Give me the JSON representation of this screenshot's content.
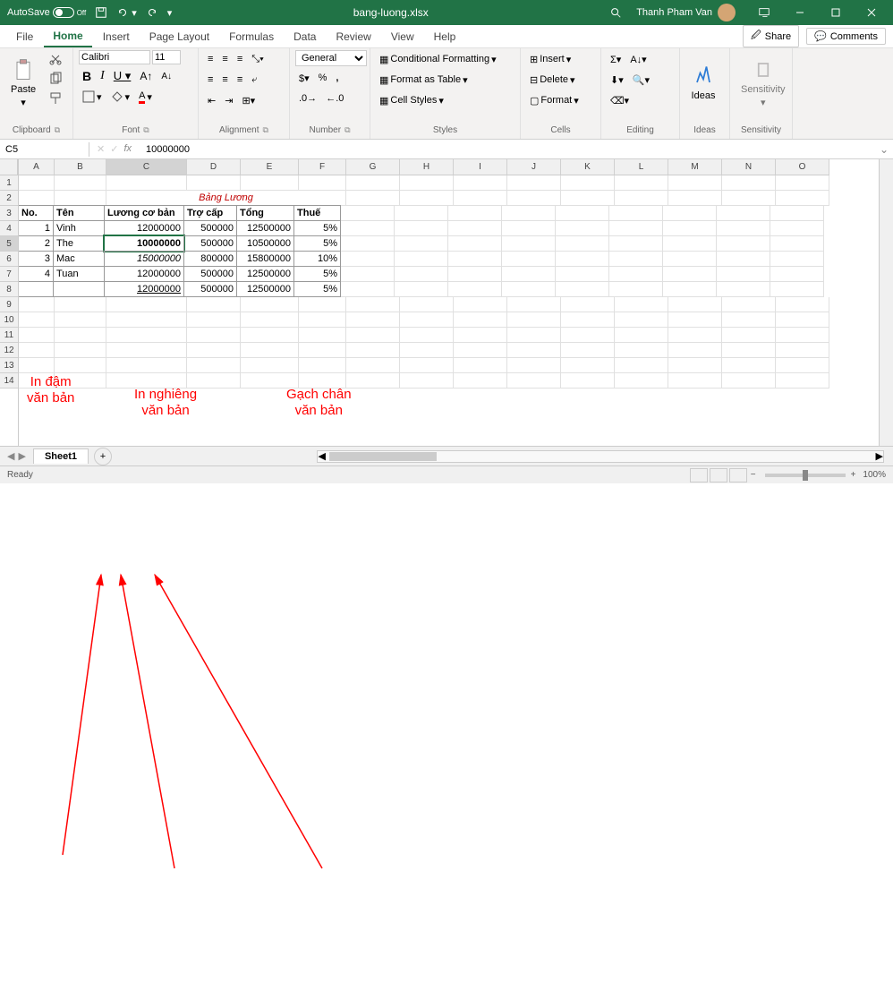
{
  "titlebar": {
    "autosave": "AutoSave",
    "autosave_state": "Off",
    "filename": "bang-luong.xlsx",
    "user": "Thanh Pham Van"
  },
  "menu": {
    "file": "File",
    "home": "Home",
    "insert": "Insert",
    "page_layout": "Page Layout",
    "formulas": "Formulas",
    "data": "Data",
    "review": "Review",
    "view": "View",
    "help": "Help",
    "share": "Share",
    "comments": "Comments"
  },
  "ribbon": {
    "clipboard": "Clipboard",
    "paste": "Paste",
    "font": "Font",
    "font_name": "Calibri",
    "font_size": "11",
    "alignment": "Alignment",
    "number": "Number",
    "number_format": "General",
    "styles": "Styles",
    "cond_fmt": "Conditional Formatting",
    "fmt_table": "Format as Table",
    "cell_styles": "Cell Styles",
    "cells": "Cells",
    "insert": "Insert",
    "delete": "Delete",
    "format": "Format",
    "editing": "Editing",
    "ideas": "Ideas",
    "sensitivity": "Sensitivity"
  },
  "namebox": {
    "ref": "C5",
    "formula": "10000000",
    "fx": "fx"
  },
  "columns": [
    "A",
    "B",
    "C",
    "D",
    "E",
    "F",
    "G",
    "H",
    "I",
    "J",
    "K",
    "L",
    "M",
    "N",
    "O"
  ],
  "rows": [
    "1",
    "2",
    "3",
    "4",
    "5",
    "6",
    "7",
    "8",
    "9",
    "10",
    "11",
    "12",
    "13",
    "14"
  ],
  "table": {
    "title": "Bảng Lương",
    "headers": {
      "no": "No.",
      "ten": "Tên",
      "luong": "Lương cơ bản",
      "trocap": "Trợ cấp",
      "tong": "Tổng",
      "thue": "Thuế"
    },
    "rows": [
      {
        "no": "1",
        "ten": "Vinh",
        "luong": "12000000",
        "trocap": "500000",
        "tong": "12500000",
        "thue": "5%"
      },
      {
        "no": "2",
        "ten": "The",
        "luong": "10000000",
        "trocap": "500000",
        "tong": "10500000",
        "thue": "5%"
      },
      {
        "no": "3",
        "ten": "Mac",
        "luong": "15000000",
        "trocap": "800000",
        "tong": "15800000",
        "thue": "10%"
      },
      {
        "no": "4",
        "ten": "Tuan",
        "luong": "12000000",
        "trocap": "500000",
        "tong": "12500000",
        "thue": "5%"
      },
      {
        "no": "",
        "ten": "",
        "luong": "12000000",
        "trocap": "500000",
        "tong": "12500000",
        "thue": "5%"
      }
    ]
  },
  "sheets": {
    "sheet1": "Sheet1"
  },
  "status": {
    "ready": "Ready",
    "zoom": "100%"
  },
  "annotations": {
    "bold": "In đậm\nvăn bản",
    "italic": "In nghiêng\nvăn bản",
    "underline": "Gạch chân\nvăn bản"
  }
}
